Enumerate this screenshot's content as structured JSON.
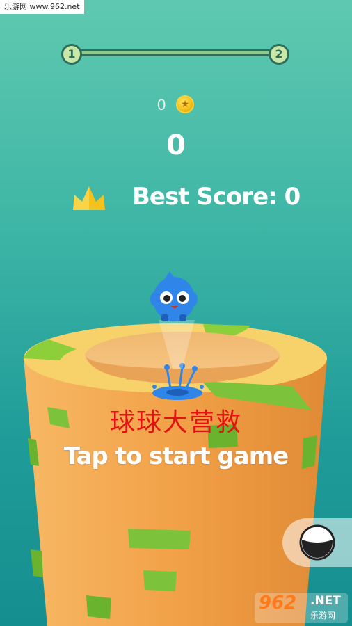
{
  "watermark_top": "乐游网 www.962.net",
  "progress": {
    "current_level": "1",
    "next_level": "2"
  },
  "coins": "0",
  "score": "0",
  "best_score_label": "Best Score: 0",
  "title_cn": "球球大营救",
  "start_prompt": "Tap to start game",
  "watermark_bottom": {
    "number": "962",
    "suffix": ".NET",
    "site_cn": "乐游网"
  },
  "colors": {
    "background": "#3fb6a6",
    "tower": "#f4a64f",
    "safe_segment": "#8ccf3a",
    "ball": "#2f86e8",
    "title": "#e51212",
    "crown": "#f5c21b"
  },
  "icons": [
    "crown-icon",
    "coin-icon",
    "ball-character",
    "skin-selector-icon"
  ]
}
